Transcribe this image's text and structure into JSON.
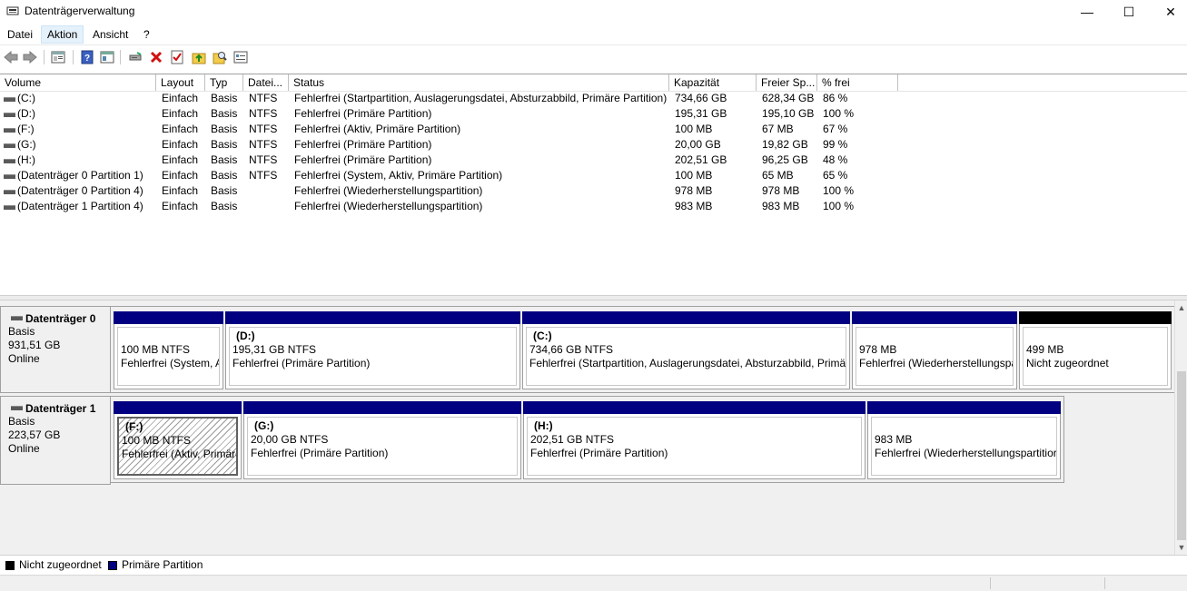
{
  "window": {
    "title": "Datenträgerverwaltung",
    "min_icon": "—",
    "max_icon": "☐",
    "close_icon": "✕"
  },
  "menu": {
    "items": [
      "Datei",
      "Aktion",
      "Ansicht",
      "?"
    ]
  },
  "toolbar": {
    "icons": [
      "back-icon",
      "forward-icon",
      "properties-view-icon",
      "help-icon",
      "console-view-icon",
      "connect-icon",
      "delete-icon",
      "check-icon",
      "up-folder-icon",
      "search-icon",
      "disk-view-icon"
    ]
  },
  "volumes": {
    "headers": [
      "Volume",
      "Layout",
      "Typ",
      "Datei...",
      "Status",
      "Kapazität",
      "Freier Sp...",
      "% frei"
    ],
    "rows": [
      [
        "(C:)",
        "Einfach",
        "Basis",
        "NTFS",
        "Fehlerfrei (Startpartition, Auslagerungsdatei, Absturzabbild, Primäre Partition)",
        "734,66 GB",
        "628,34 GB",
        "86 %"
      ],
      [
        "(D:)",
        "Einfach",
        "Basis",
        "NTFS",
        "Fehlerfrei (Primäre Partition)",
        "195,31 GB",
        "195,10 GB",
        "100 %"
      ],
      [
        "(F:)",
        "Einfach",
        "Basis",
        "NTFS",
        "Fehlerfrei (Aktiv, Primäre Partition)",
        "100 MB",
        "67 MB",
        "67 %"
      ],
      [
        "(G:)",
        "Einfach",
        "Basis",
        "NTFS",
        "Fehlerfrei (Primäre Partition)",
        "20,00 GB",
        "19,82 GB",
        "99 %"
      ],
      [
        "(H:)",
        "Einfach",
        "Basis",
        "NTFS",
        "Fehlerfrei (Primäre Partition)",
        "202,51 GB",
        "96,25 GB",
        "48 %"
      ],
      [
        "(Datenträger 0 Partition 1)",
        "Einfach",
        "Basis",
        "NTFS",
        "Fehlerfrei (System, Aktiv, Primäre Partition)",
        "100 MB",
        "65 MB",
        "65 %"
      ],
      [
        "(Datenträger 0 Partition 4)",
        "Einfach",
        "Basis",
        "",
        "Fehlerfrei (Wiederherstellungspartition)",
        "978 MB",
        "978 MB",
        "100 %"
      ],
      [
        "(Datenträger 1 Partition 4)",
        "Einfach",
        "Basis",
        "",
        "Fehlerfrei (Wiederherstellungspartition)",
        "983 MB",
        "983 MB",
        "100 %"
      ]
    ]
  },
  "disks": [
    {
      "name": "Datenträger 0",
      "type": "Basis",
      "size": "931,51 GB",
      "status": "Online",
      "partitions": [
        {
          "name": "",
          "size": "100 MB NTFS",
          "status": "Fehlerfrei (System, A",
          "kind": "primary"
        },
        {
          "name": "(D:)",
          "size": "195,31 GB NTFS",
          "status": "Fehlerfrei (Primäre Partition)",
          "kind": "primary"
        },
        {
          "name": "(C:)",
          "size": "734,66 GB NTFS",
          "status": "Fehlerfrei (Startpartition, Auslagerungsdatei, Absturzabbild, Primä",
          "kind": "primary"
        },
        {
          "name": "",
          "size": "978 MB",
          "status": "Fehlerfrei (Wiederherstellungspa",
          "kind": "primary"
        },
        {
          "name": "",
          "size": "499 MB",
          "status": "Nicht zugeordnet",
          "kind": "unallocated"
        }
      ]
    },
    {
      "name": "Datenträger 1",
      "type": "Basis",
      "size": "223,57 GB",
      "status": "Online",
      "partitions": [
        {
          "name": "(F:)",
          "size": "100 MB NTFS",
          "status": "Fehlerfrei (Aktiv, Primäre",
          "kind": "primary-selected"
        },
        {
          "name": "(G:)",
          "size": "20,00 GB NTFS",
          "status": "Fehlerfrei (Primäre Partition)",
          "kind": "primary"
        },
        {
          "name": "(H:)",
          "size": "202,51 GB NTFS",
          "status": "Fehlerfrei (Primäre Partition)",
          "kind": "primary"
        },
        {
          "name": "",
          "size": "983 MB",
          "status": "Fehlerfrei (Wiederherstellungspartitior",
          "kind": "primary"
        }
      ]
    }
  ],
  "legend": [
    {
      "label": "Nicht zugeordnet",
      "color": "#000000"
    },
    {
      "label": "Primäre Partition",
      "color": "#000080"
    }
  ],
  "scroll": {
    "up": "▲",
    "down": "▼"
  },
  "colors": {
    "primary": "#000080",
    "unallocated": "#000000"
  }
}
